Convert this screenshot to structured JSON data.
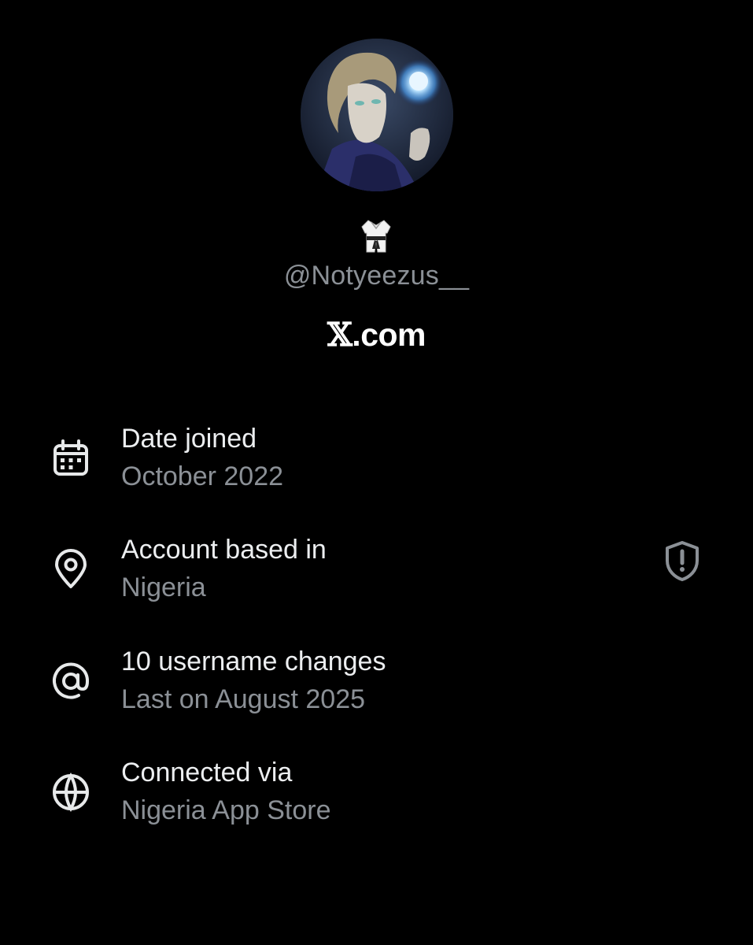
{
  "profile": {
    "display_name_emoji": "martial-arts-uniform-emoji",
    "handle": "@Notyeezus__",
    "brand_prefix": "𝕏",
    "brand_suffix": ".com",
    "avatar": "anime-character-avatar"
  },
  "rows": [
    {
      "icon": "calendar-icon",
      "title": "Date joined",
      "subtitle": "October 2022"
    },
    {
      "icon": "location-pin-icon",
      "title": "Account based in",
      "subtitle": "Nigeria",
      "trailing_icon": "shield-alert-icon"
    },
    {
      "icon": "at-sign-icon",
      "title": "10 username changes",
      "subtitle": "Last on August 2025"
    },
    {
      "icon": "globe-icon",
      "title": "Connected via",
      "subtitle": "Nigeria App Store"
    }
  ],
  "colors": {
    "background": "#000000",
    "primary_text": "#e7e9ea",
    "secondary_text": "#8b9096",
    "avatar_glow": "#9fd4ff"
  }
}
